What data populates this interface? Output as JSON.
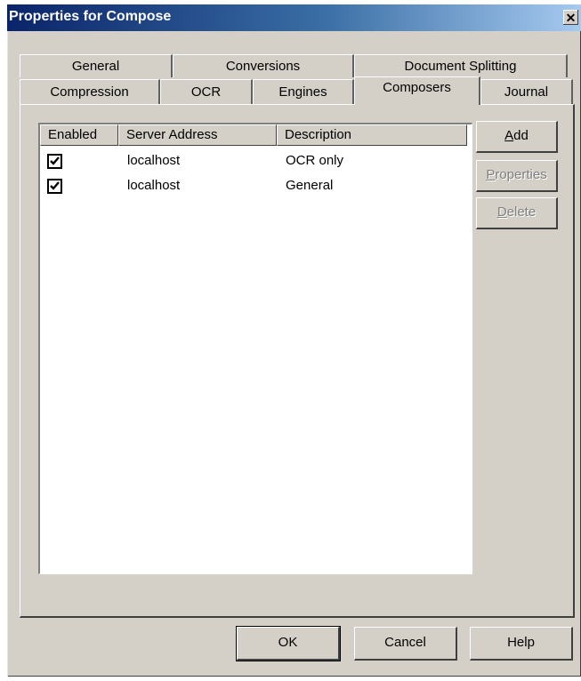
{
  "window": {
    "title": "Properties for Compose",
    "close_glyph": "✕"
  },
  "tabs": {
    "back_row": [
      {
        "label": "General"
      },
      {
        "label": "Conversions"
      },
      {
        "label": "Document Splitting"
      }
    ],
    "front_row": [
      {
        "label": "Compression"
      },
      {
        "label": "OCR"
      },
      {
        "label": "Engines"
      },
      {
        "label": "Composers",
        "active": true
      },
      {
        "label": "Journal"
      }
    ]
  },
  "list": {
    "columns": [
      "Enabled",
      "Server Address",
      "Description"
    ],
    "rows": [
      {
        "enabled": true,
        "server_address": "localhost",
        "description": "OCR only"
      },
      {
        "enabled": true,
        "server_address": "localhost",
        "description": "General"
      }
    ]
  },
  "side_buttons": {
    "add": {
      "mnemonic": "A",
      "rest": "dd",
      "enabled": true
    },
    "properties": {
      "mnemonic": "P",
      "rest": "roperties",
      "enabled": false
    },
    "delete": {
      "mnemonic": "D",
      "rest": "elete",
      "enabled": false
    }
  },
  "dialog_buttons": {
    "ok": "OK",
    "cancel": "Cancel",
    "help": "Help"
  },
  "icons": {
    "checkbox": "check-icon",
    "close": "close-icon"
  },
  "colors": {
    "title_start": "#0a246a",
    "title_end": "#a6caf0",
    "face": "#d4d0c8",
    "disabled_text": "#808080"
  }
}
